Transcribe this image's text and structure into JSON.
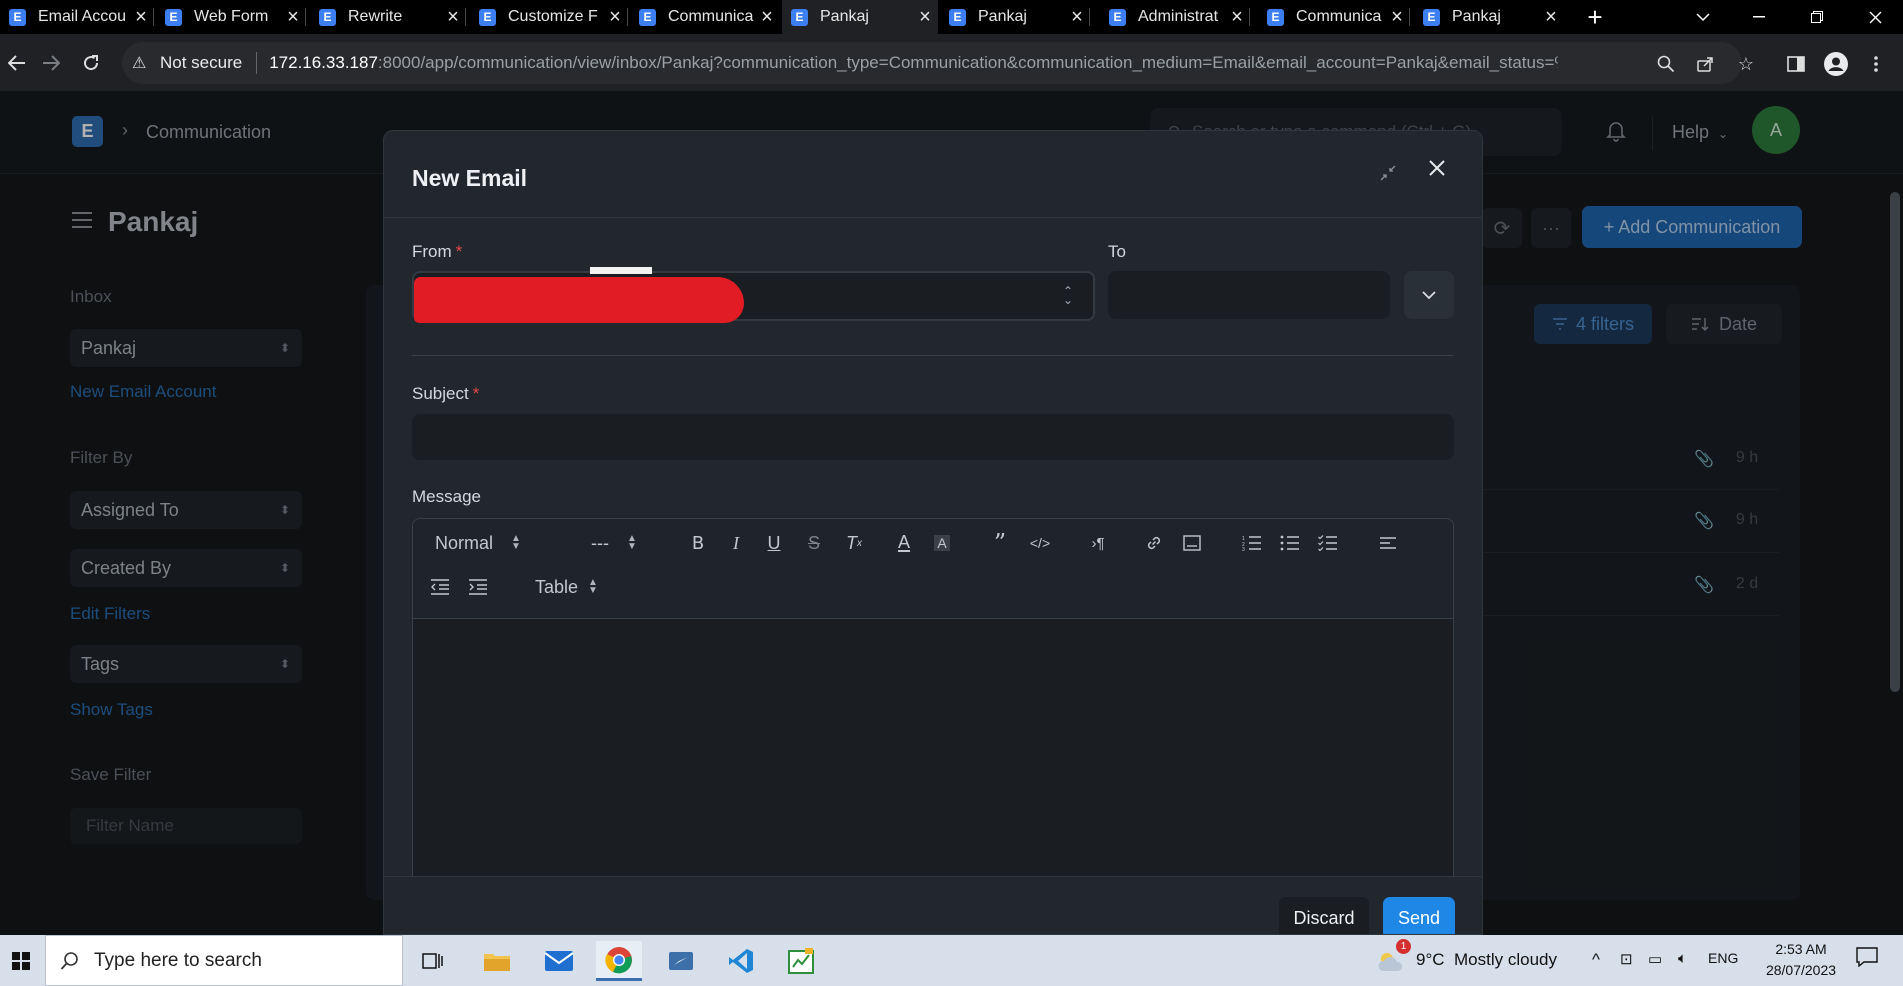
{
  "browser": {
    "tabs": [
      {
        "title": "Email Accou",
        "active": false
      },
      {
        "title": "Web Form",
        "active": false
      },
      {
        "title": "Rewrite",
        "active": false
      },
      {
        "title": "Customize F",
        "active": false
      },
      {
        "title": "Communica",
        "active": false
      },
      {
        "title": "Pankaj",
        "active": true
      },
      {
        "title": "Pankaj",
        "active": false
      },
      {
        "title": "Administrat",
        "active": false
      },
      {
        "title": "Communica",
        "active": false
      },
      {
        "title": "Pankaj",
        "active": false
      }
    ],
    "security_label": "Not secure",
    "url_host": "172.16.33.187",
    "url_path": ":8000/app/communication/view/inbox/Pankaj?communication_type=Communication&communication_medium=Email&email_account=Pankaj&email_status=%5B..."
  },
  "navbar": {
    "logo_letter": "E",
    "breadcrumb": "Communication",
    "search_placeholder": "Search or type a command (Ctrl + G)",
    "help_label": "Help",
    "avatar_initial": "A"
  },
  "page": {
    "title": "Pankaj",
    "add_button_label": "+ Add Communication",
    "filters_label": "4 filters",
    "sort_label": "Date",
    "rows": [
      {
        "age": "9 h"
      },
      {
        "age": "9 h"
      },
      {
        "age": "2 d"
      }
    ]
  },
  "sidebar": {
    "inbox_label": "Inbox",
    "inbox_value": "Pankaj",
    "new_email_account": "New Email Account",
    "filter_by_label": "Filter By",
    "assigned_to": "Assigned To",
    "created_by": "Created By",
    "edit_filters": "Edit Filters",
    "tags": "Tags",
    "show_tags": "Show Tags",
    "save_filter_label": "Save Filter",
    "filter_name_placeholder": "Filter Name"
  },
  "modal": {
    "title": "New Email",
    "from_label": "From",
    "to_label": "To",
    "subject_label": "Subject",
    "message_label": "Message",
    "toolbar": {
      "style_select": "Normal",
      "size_select": "---",
      "table_select": "Table"
    },
    "discard_label": "Discard",
    "send_label": "Send"
  },
  "taskbar": {
    "search_placeholder": "Type here to search",
    "weather_temp": "9°C",
    "weather_text": "Mostly cloudy",
    "weather_badge": "1",
    "language": "ENG",
    "time": "2:53 AM",
    "date": "28/07/2023"
  },
  "colors": {
    "accent_blue": "#2066b0",
    "send_blue": "#1f87e5",
    "required_red": "#e5484d",
    "avatar_green": "#2e7d3d"
  }
}
